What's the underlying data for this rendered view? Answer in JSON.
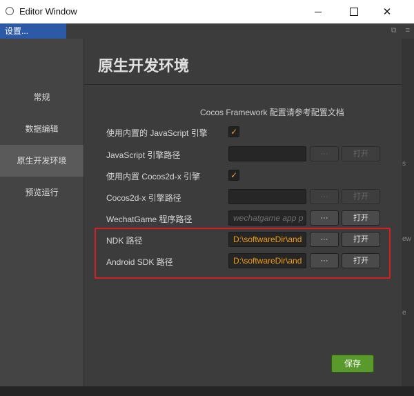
{
  "window": {
    "title": "Editor Window"
  },
  "strip": {
    "tab_label": "设置..."
  },
  "sidebar": {
    "items": [
      {
        "label": "常规"
      },
      {
        "label": "数据编辑"
      },
      {
        "label": "原生开发环境"
      },
      {
        "label": "预览运行"
      }
    ],
    "active_index": 2
  },
  "main": {
    "heading": "原生开发环境",
    "framework_note": "Cocos Framework 配置请参考配置文档",
    "rows": [
      {
        "label": "使用内置的 JavaScript 引擎",
        "checked": true
      },
      {
        "label": "JavaScript 引擎路径",
        "value": "",
        "dots": "···",
        "open": "打开"
      },
      {
        "label": "使用内置 Cocos2d-x 引擎",
        "checked": true
      },
      {
        "label": "Cocos2d-x 引擎路径",
        "value": "",
        "dots": "···",
        "open": "打开"
      },
      {
        "label": "WechatGame 程序路径",
        "placeholder": "wechatgame app p",
        "dots": "···",
        "open": "打开"
      },
      {
        "label": "NDK 路径",
        "value": "D:\\softwareDir\\and",
        "dots": "···",
        "open": "打开"
      },
      {
        "label": "Android SDK 路径",
        "value": "D:\\softwareDir\\and",
        "dots": "···",
        "open": "打开"
      }
    ],
    "save_label": "保存"
  },
  "background_fragments": [
    "s",
    "ew",
    "e"
  ],
  "colors": {
    "accent_orange": "#f39c12",
    "save_green": "#5a9a2d",
    "highlight_red": "#d42020",
    "tab_blue": "#2d5aa6"
  }
}
